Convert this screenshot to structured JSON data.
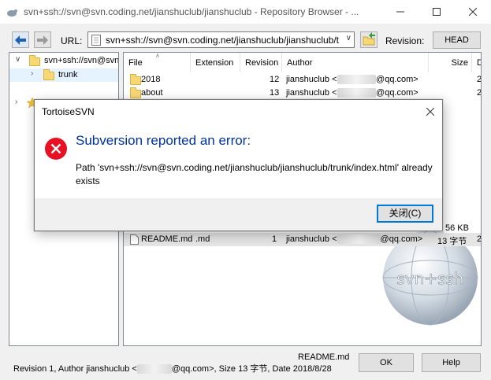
{
  "window": {
    "title": "svn+ssh://svn@svn.coding.net/jianshuclub/jianshuclub - Repository Browser - ..."
  },
  "toolbar": {
    "url_label": "URL:",
    "url_value": "svn+ssh://svn@svn.coding.net/jianshuclub/jianshuclub/trunk",
    "revision_label": "Revision:",
    "revision_button": "HEAD"
  },
  "tree": {
    "root_label": "svn+ssh://svn@svn",
    "child_label": "trunk"
  },
  "list": {
    "columns": [
      "File",
      "Extension",
      "Revision",
      "Author",
      "Size",
      "D"
    ],
    "rows": [
      {
        "file": "2018",
        "ext": "",
        "rev": "12",
        "author_pre": "jianshuclub <",
        "author_post": "@qq.com>",
        "size": "",
        "date": "2"
      },
      {
        "file": "about",
        "ext": "",
        "rev": "13",
        "author_pre": "jianshuclub <",
        "author_post": "@qq.com>",
        "size": "",
        "date": "2"
      }
    ],
    "partial_size": "56 KB",
    "selected_row": {
      "file": "README.md",
      "ext": ".md",
      "rev": "1",
      "author_pre": "jianshuclub <",
      "author_post": "@qq.com>",
      "size": "13 字节",
      "date": "2"
    },
    "watermark_text": "svn+ssh"
  },
  "dialog": {
    "title": "TortoiseSVN",
    "heading": "Subversion reported an error:",
    "message": "Path 'svn+ssh://svn@svn.coding.net/jianshuclub/jianshuclub/trunk/index.html' already exists",
    "close_button": "关闭(C)"
  },
  "status": {
    "filename": "README.md",
    "text_pre": "Revision 1, Author jianshuclub <",
    "text_post": "@qq.com>, Size 13 字节, Date 2018/8/28"
  },
  "buttons": {
    "ok": "OK",
    "help": "Help"
  },
  "colors": {
    "error_heading": "#003399",
    "error_icon": "#e81123",
    "selection": "#e5f3ff",
    "focus_border": "#0078d7"
  }
}
